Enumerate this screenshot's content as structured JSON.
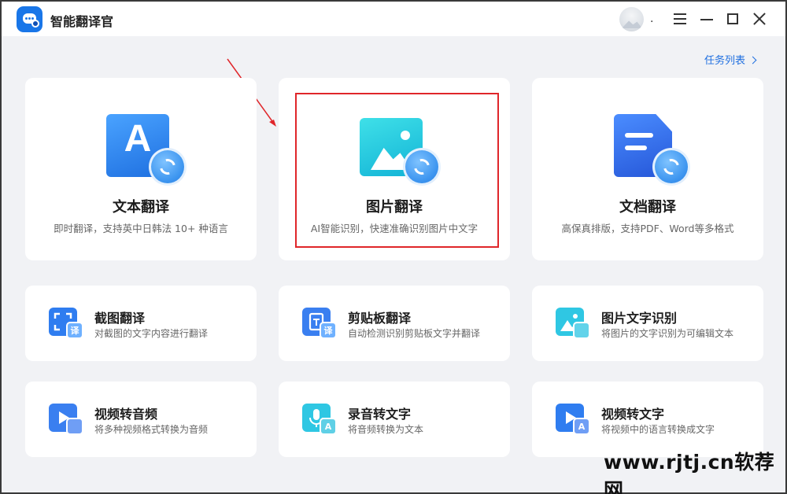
{
  "app": {
    "title": "智能翻译官"
  },
  "header": {
    "avatar_dot": "."
  },
  "task_list": {
    "label": "任务列表"
  },
  "feature_cards": [
    {
      "title": "文本翻译",
      "desc": "即时翻译，支持英中日韩法 10+ 种语言",
      "icon": "text-translate-icon"
    },
    {
      "title": "图片翻译",
      "desc": "AI智能识别，快速准确识别图片中文字",
      "icon": "image-translate-icon"
    },
    {
      "title": "文档翻译",
      "desc": "高保真排版，支持PDF、Word等多格式",
      "icon": "document-translate-icon"
    }
  ],
  "tool_cards": [
    {
      "title": "截图翻译",
      "desc": "对截图的文字内容进行翻译",
      "icon": "screenshot-translate-icon",
      "badge": "译"
    },
    {
      "title": "剪贴板翻译",
      "desc": "自动检测识别剪贴板文字并翻译",
      "icon": "clipboard-translate-icon",
      "badge": "译"
    },
    {
      "title": "图片文字识别",
      "desc": "将图片的文字识别为可编辑文本",
      "icon": "image-ocr-icon",
      "badge": ""
    },
    {
      "title": "视频转音频",
      "desc": "将多种视频格式转换为音频",
      "icon": "video-to-audio-icon",
      "badge": ""
    },
    {
      "title": "录音转文字",
      "desc": "将音频转换为文本",
      "icon": "audio-to-text-icon",
      "badge": "A"
    },
    {
      "title": "视频转文字",
      "desc": "将视频中的语言转换成文字",
      "icon": "video-to-text-icon",
      "badge": "A"
    }
  ],
  "watermark": "www.rjtj.cn软荐网",
  "colors": {
    "accent": "#1f6fe0",
    "highlight": "#e0262a",
    "background": "#f1f2f5"
  }
}
